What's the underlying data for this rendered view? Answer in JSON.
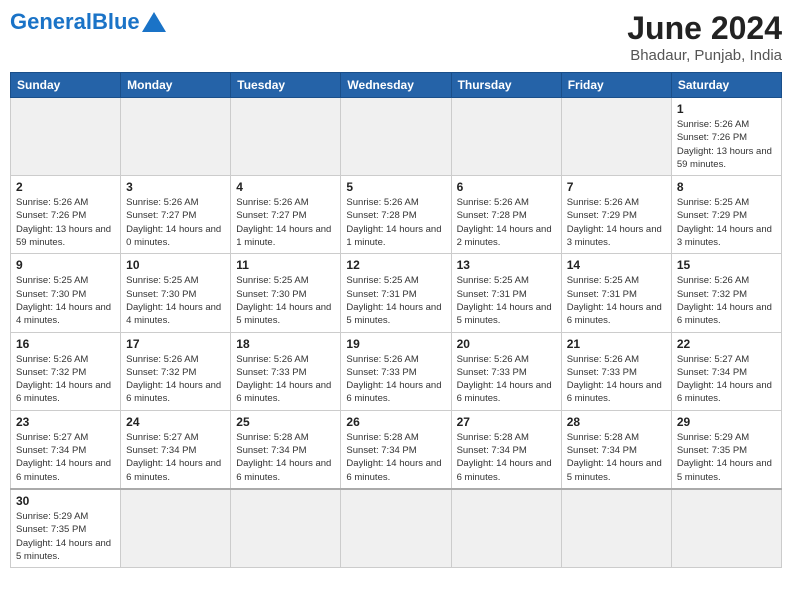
{
  "header": {
    "logo_general": "General",
    "logo_blue": "Blue",
    "month_year": "June 2024",
    "location": "Bhadaur, Punjab, India"
  },
  "days_of_week": [
    "Sunday",
    "Monday",
    "Tuesday",
    "Wednesday",
    "Thursday",
    "Friday",
    "Saturday"
  ],
  "weeks": [
    [
      {
        "day": "",
        "empty": true
      },
      {
        "day": "",
        "empty": true
      },
      {
        "day": "",
        "empty": true
      },
      {
        "day": "",
        "empty": true
      },
      {
        "day": "",
        "empty": true
      },
      {
        "day": "",
        "empty": true
      },
      {
        "day": "1",
        "info": "Sunrise: 5:26 AM\nSunset: 7:26 PM\nDaylight: 13 hours\nand 59 minutes."
      }
    ],
    [
      {
        "day": "2",
        "info": "Sunrise: 5:26 AM\nSunset: 7:26 PM\nDaylight: 13 hours\nand 59 minutes."
      },
      {
        "day": "3",
        "info": "Sunrise: 5:26 AM\nSunset: 7:27 PM\nDaylight: 14 hours\nand 0 minutes."
      },
      {
        "day": "4",
        "info": "Sunrise: 5:26 AM\nSunset: 7:27 PM\nDaylight: 14 hours\nand 1 minute."
      },
      {
        "day": "5",
        "info": "Sunrise: 5:26 AM\nSunset: 7:28 PM\nDaylight: 14 hours\nand 1 minute."
      },
      {
        "day": "6",
        "info": "Sunrise: 5:26 AM\nSunset: 7:28 PM\nDaylight: 14 hours\nand 2 minutes."
      },
      {
        "day": "7",
        "info": "Sunrise: 5:26 AM\nSunset: 7:29 PM\nDaylight: 14 hours\nand 3 minutes."
      },
      {
        "day": "8",
        "info": "Sunrise: 5:25 AM\nSunset: 7:29 PM\nDaylight: 14 hours\nand 3 minutes."
      }
    ],
    [
      {
        "day": "9",
        "info": "Sunrise: 5:25 AM\nSunset: 7:30 PM\nDaylight: 14 hours\nand 4 minutes."
      },
      {
        "day": "10",
        "info": "Sunrise: 5:25 AM\nSunset: 7:30 PM\nDaylight: 14 hours\nand 4 minutes."
      },
      {
        "day": "11",
        "info": "Sunrise: 5:25 AM\nSunset: 7:30 PM\nDaylight: 14 hours\nand 5 minutes."
      },
      {
        "day": "12",
        "info": "Sunrise: 5:25 AM\nSunset: 7:31 PM\nDaylight: 14 hours\nand 5 minutes."
      },
      {
        "day": "13",
        "info": "Sunrise: 5:25 AM\nSunset: 7:31 PM\nDaylight: 14 hours\nand 5 minutes."
      },
      {
        "day": "14",
        "info": "Sunrise: 5:25 AM\nSunset: 7:31 PM\nDaylight: 14 hours\nand 6 minutes."
      },
      {
        "day": "15",
        "info": "Sunrise: 5:26 AM\nSunset: 7:32 PM\nDaylight: 14 hours\nand 6 minutes."
      }
    ],
    [
      {
        "day": "16",
        "info": "Sunrise: 5:26 AM\nSunset: 7:32 PM\nDaylight: 14 hours\nand 6 minutes."
      },
      {
        "day": "17",
        "info": "Sunrise: 5:26 AM\nSunset: 7:32 PM\nDaylight: 14 hours\nand 6 minutes."
      },
      {
        "day": "18",
        "info": "Sunrise: 5:26 AM\nSunset: 7:33 PM\nDaylight: 14 hours\nand 6 minutes."
      },
      {
        "day": "19",
        "info": "Sunrise: 5:26 AM\nSunset: 7:33 PM\nDaylight: 14 hours\nand 6 minutes."
      },
      {
        "day": "20",
        "info": "Sunrise: 5:26 AM\nSunset: 7:33 PM\nDaylight: 14 hours\nand 6 minutes."
      },
      {
        "day": "21",
        "info": "Sunrise: 5:26 AM\nSunset: 7:33 PM\nDaylight: 14 hours\nand 6 minutes."
      },
      {
        "day": "22",
        "info": "Sunrise: 5:27 AM\nSunset: 7:34 PM\nDaylight: 14 hours\nand 6 minutes."
      }
    ],
    [
      {
        "day": "23",
        "info": "Sunrise: 5:27 AM\nSunset: 7:34 PM\nDaylight: 14 hours\nand 6 minutes."
      },
      {
        "day": "24",
        "info": "Sunrise: 5:27 AM\nSunset: 7:34 PM\nDaylight: 14 hours\nand 6 minutes."
      },
      {
        "day": "25",
        "info": "Sunrise: 5:28 AM\nSunset: 7:34 PM\nDaylight: 14 hours\nand 6 minutes."
      },
      {
        "day": "26",
        "info": "Sunrise: 5:28 AM\nSunset: 7:34 PM\nDaylight: 14 hours\nand 6 minutes."
      },
      {
        "day": "27",
        "info": "Sunrise: 5:28 AM\nSunset: 7:34 PM\nDaylight: 14 hours\nand 6 minutes."
      },
      {
        "day": "28",
        "info": "Sunrise: 5:28 AM\nSunset: 7:34 PM\nDaylight: 14 hours\nand 5 minutes."
      },
      {
        "day": "29",
        "info": "Sunrise: 5:29 AM\nSunset: 7:35 PM\nDaylight: 14 hours\nand 5 minutes."
      }
    ],
    [
      {
        "day": "30",
        "info": "Sunrise: 5:29 AM\nSunset: 7:35 PM\nDaylight: 14 hours\nand 5 minutes."
      },
      {
        "day": "",
        "empty": true
      },
      {
        "day": "",
        "empty": true
      },
      {
        "day": "",
        "empty": true
      },
      {
        "day": "",
        "empty": true
      },
      {
        "day": "",
        "empty": true
      },
      {
        "day": "",
        "empty": true
      }
    ]
  ]
}
